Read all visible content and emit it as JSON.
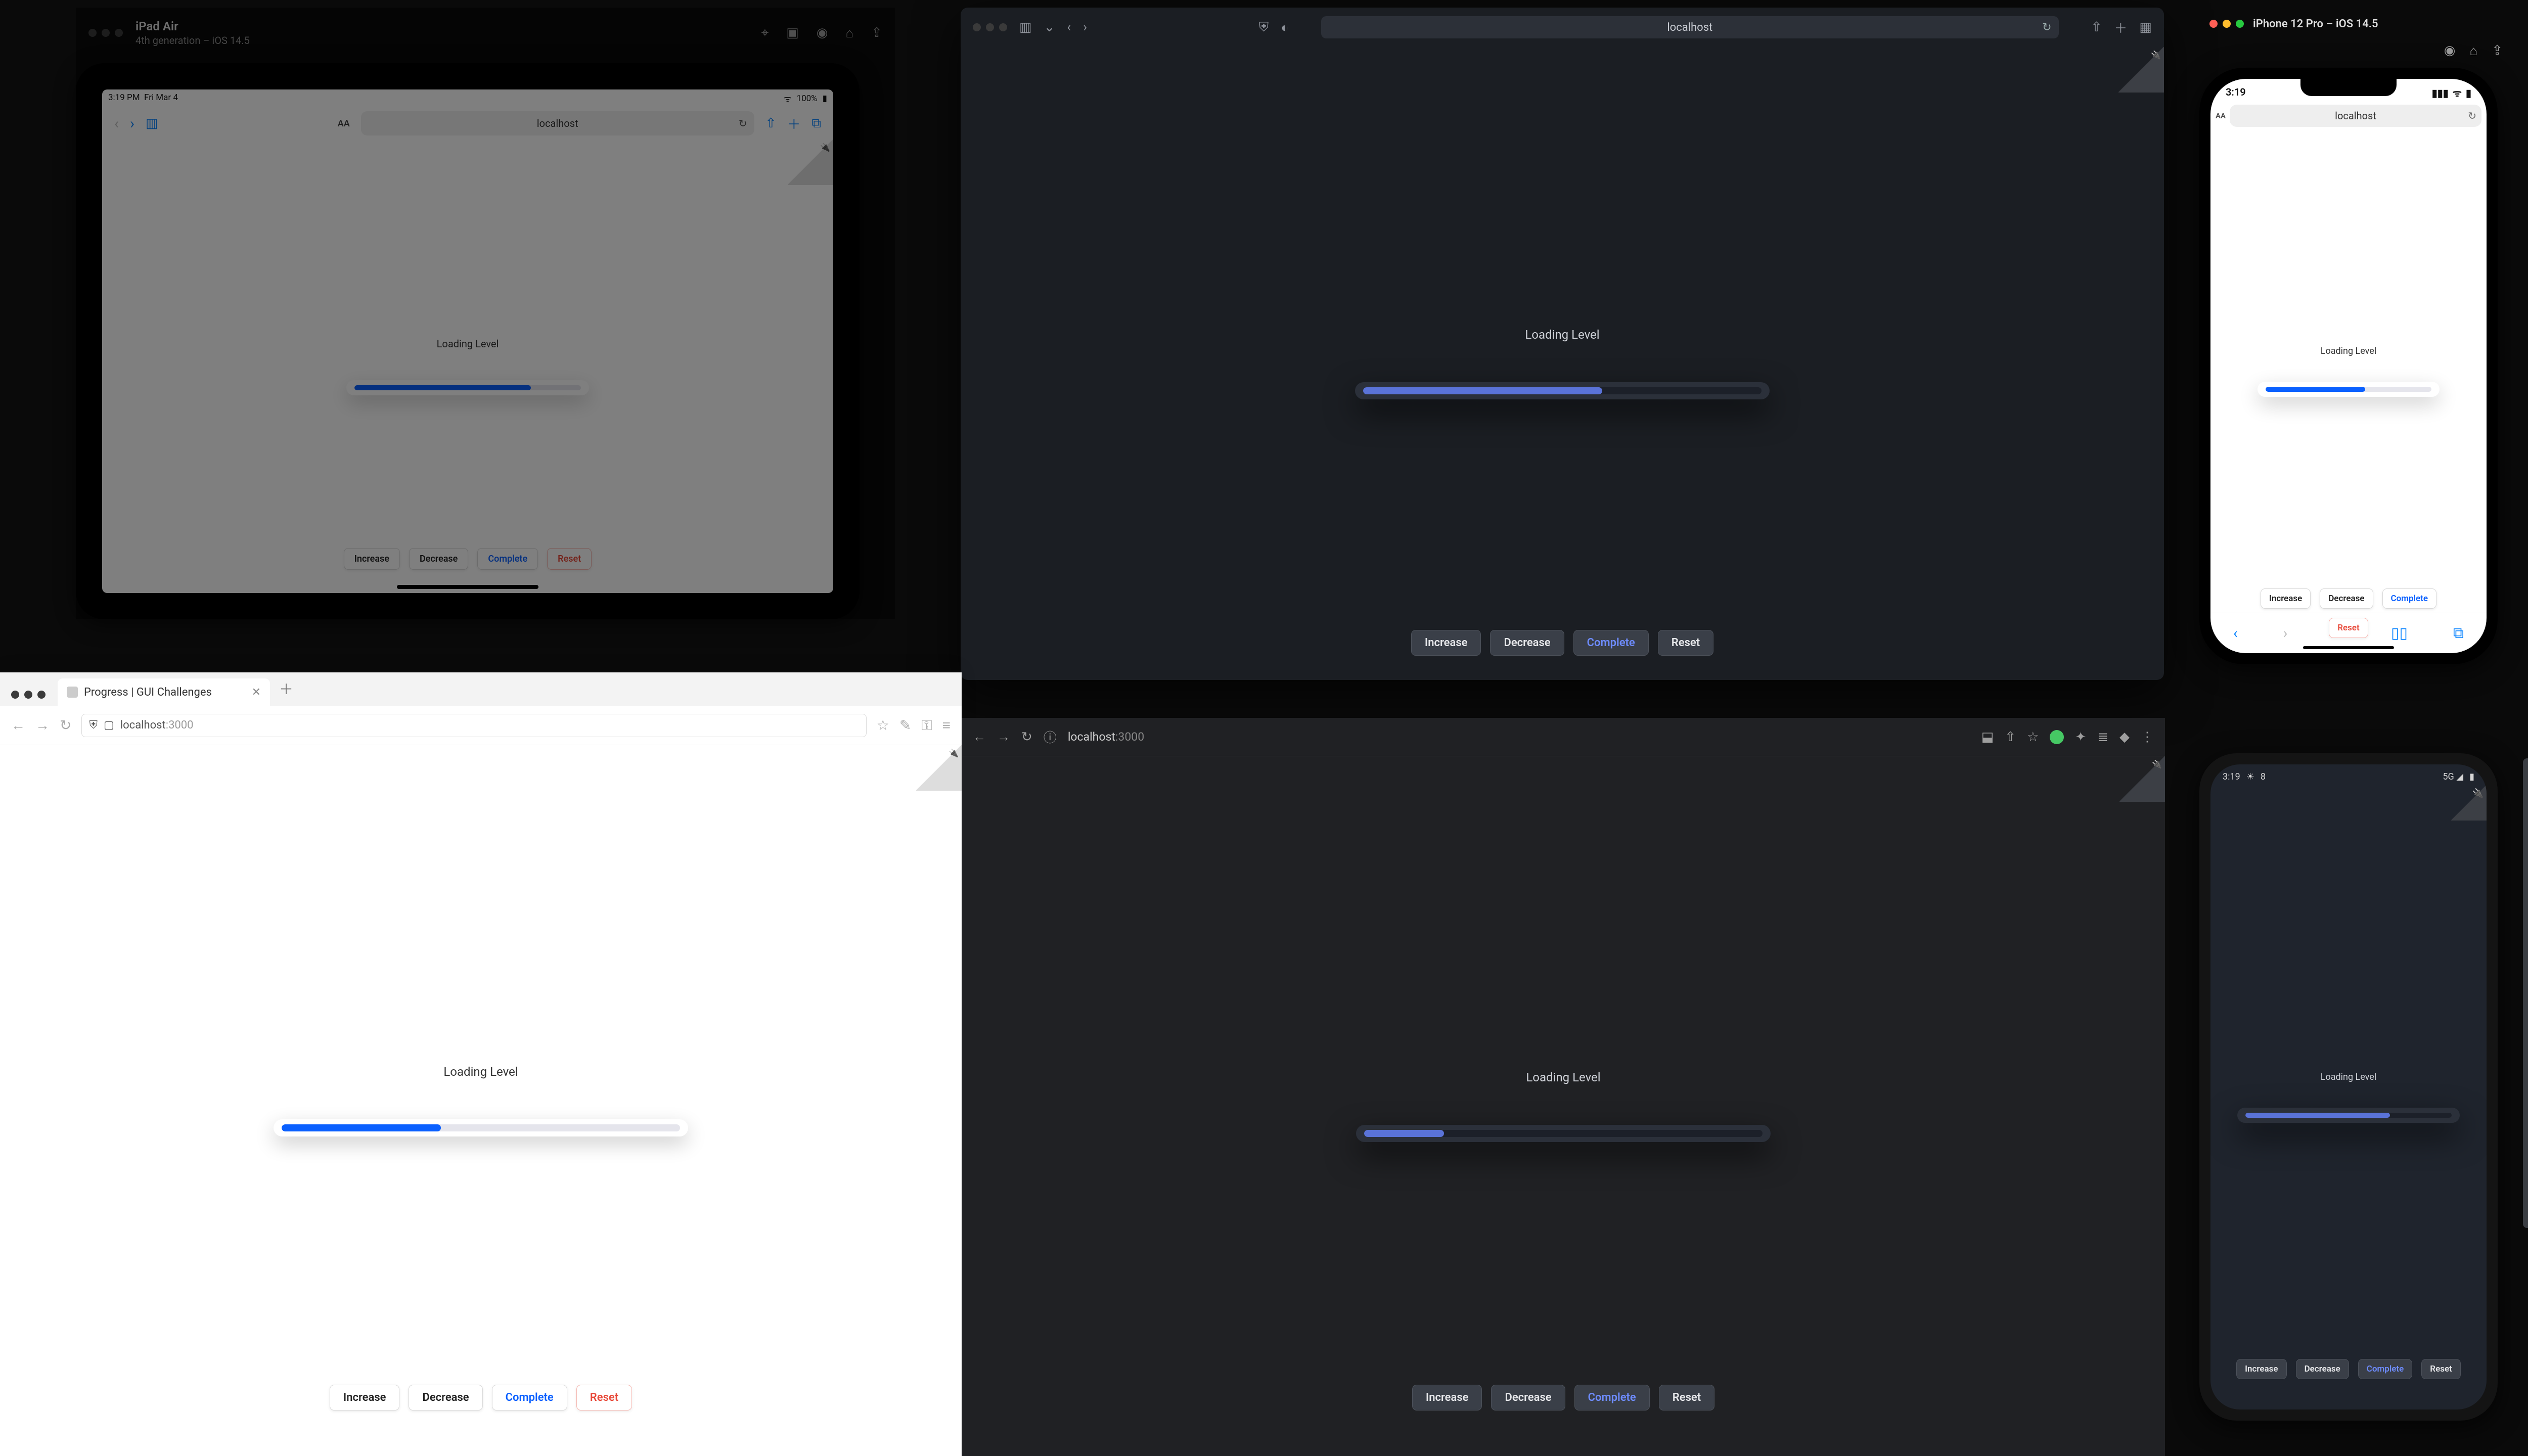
{
  "demo": {
    "title": "Loading Level",
    "buttons": {
      "increase": "Increase",
      "decrease": "Decrease",
      "complete": "Complete",
      "reset": "Reset"
    }
  },
  "ipad_sim": {
    "device": "iPad Air",
    "device_sub": "4th generation – iOS 14.5",
    "status": {
      "time": "3:19 PM",
      "date": "Fri Mar 4",
      "wifi": "100%"
    },
    "url": "localhost",
    "progress_pct": 78
  },
  "safari": {
    "url": "localhost",
    "progress_pct": 60
  },
  "iphone_sim": {
    "device": "iPhone 12 Pro – iOS 14.5",
    "status_time": "3:19",
    "url": "localhost",
    "progress_pct": 60
  },
  "firefox_light": {
    "tab_title": "Progress | GUI Challenges",
    "url_host": "localhost",
    "url_port": ":3000",
    "progress_pct": 40
  },
  "chrome_dark": {
    "url_host": "localhost",
    "url_port": ":3000",
    "progress_pct": 20
  },
  "android": {
    "status_time": "3:19",
    "status_temp": "8",
    "progress_pct": 70
  },
  "emu_toolbar_icons": [
    "power",
    "vol-up",
    "vol-down",
    "rotate-left",
    "rotate-right",
    "camera",
    "zoom",
    "back",
    "home",
    "square",
    "more"
  ]
}
